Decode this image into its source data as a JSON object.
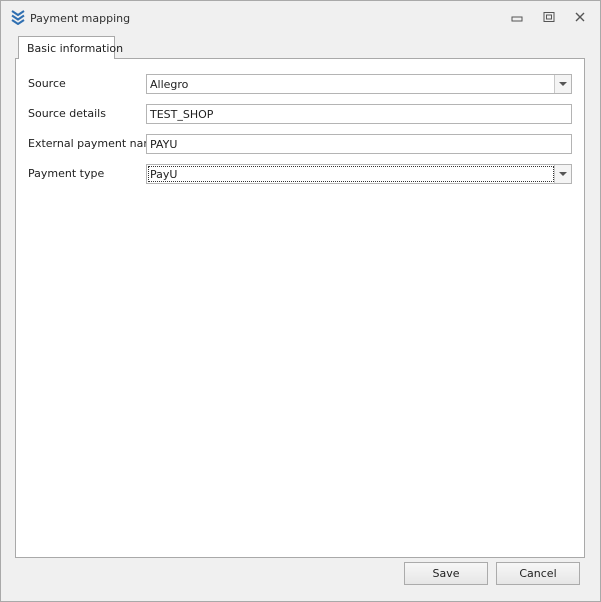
{
  "window": {
    "title": "Payment mapping",
    "icon": "layers-chevron-icon",
    "controls": [
      "minimize-icon",
      "maximize-icon",
      "close-icon"
    ]
  },
  "tabs": [
    {
      "label": "Basic information",
      "active": true
    }
  ],
  "form": {
    "fields": [
      {
        "label": "Source",
        "value": "Allegro",
        "type": "dropdown"
      },
      {
        "label": "Source details",
        "value": "TEST_SHOP",
        "type": "text"
      },
      {
        "label": "External payment name",
        "value": "PAYU",
        "type": "text"
      },
      {
        "label": "Payment type",
        "value": "PayU",
        "type": "dropdown",
        "focused": true
      }
    ]
  },
  "footer": {
    "save_label": "Save",
    "cancel_label": "Cancel"
  },
  "colors": {
    "background": "#f0f0f0",
    "panel": "#ffffff",
    "border": "#a9a9a9",
    "icon_accent": "#2f6fb1"
  }
}
